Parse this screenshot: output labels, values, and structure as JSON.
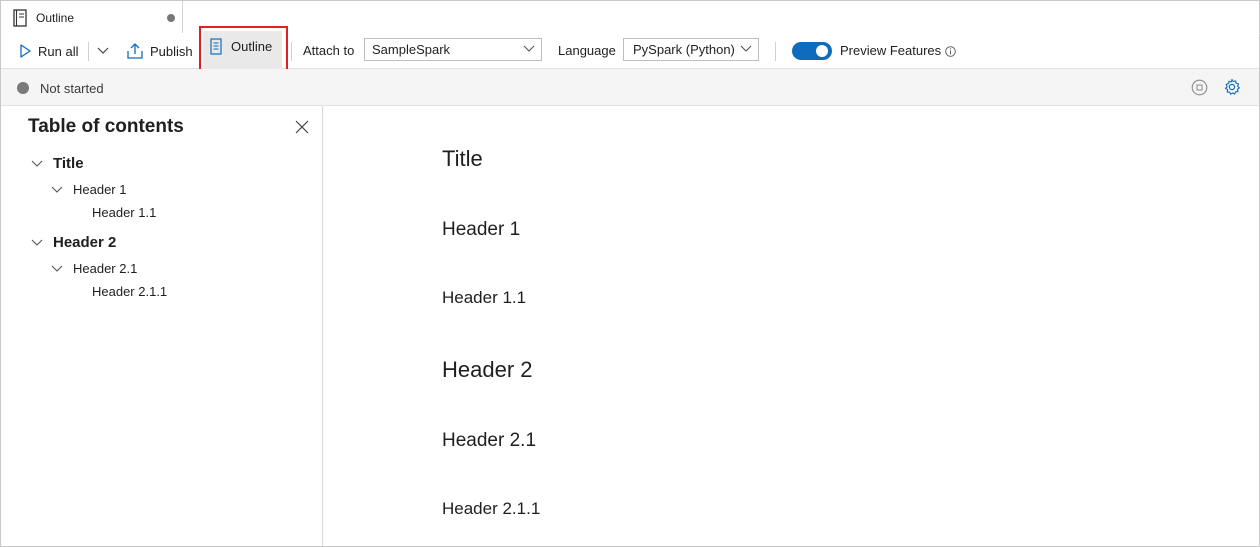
{
  "tab": {
    "title": "Outline",
    "icon": "notebook-icon"
  },
  "toolbar": {
    "run_all_label": "Run all",
    "publish_label": "Publish",
    "outline_label": "Outline",
    "attach_to_label": "Attach to",
    "attach_to_value": "SampleSpark",
    "language_label": "Language",
    "language_value": "PySpark (Python)",
    "preview_features_label": "Preview Features",
    "preview_features_enabled": true,
    "accent_color": "#0f6cbd",
    "highlight_color": "#e02020"
  },
  "status": {
    "text": "Not started"
  },
  "toc": {
    "title": "Table of contents",
    "items": [
      {
        "label": "Title",
        "level": 1
      },
      {
        "label": "Header 1",
        "level": 2
      },
      {
        "label": "Header 1.1",
        "level": 3
      },
      {
        "label": "Header 2",
        "level": 1
      },
      {
        "label": "Header 2.1",
        "level": 2
      },
      {
        "label": "Header 2.1.1",
        "level": 3
      }
    ]
  },
  "content": {
    "headings": [
      {
        "text": "Title",
        "level": 1
      },
      {
        "text": "Header 1",
        "level": 2
      },
      {
        "text": "Header 1.1",
        "level": 3
      },
      {
        "text": "Header 2",
        "level": 1
      },
      {
        "text": "Header 2.1",
        "level": 2
      },
      {
        "text": "Header 2.1.1",
        "level": 3
      }
    ]
  }
}
